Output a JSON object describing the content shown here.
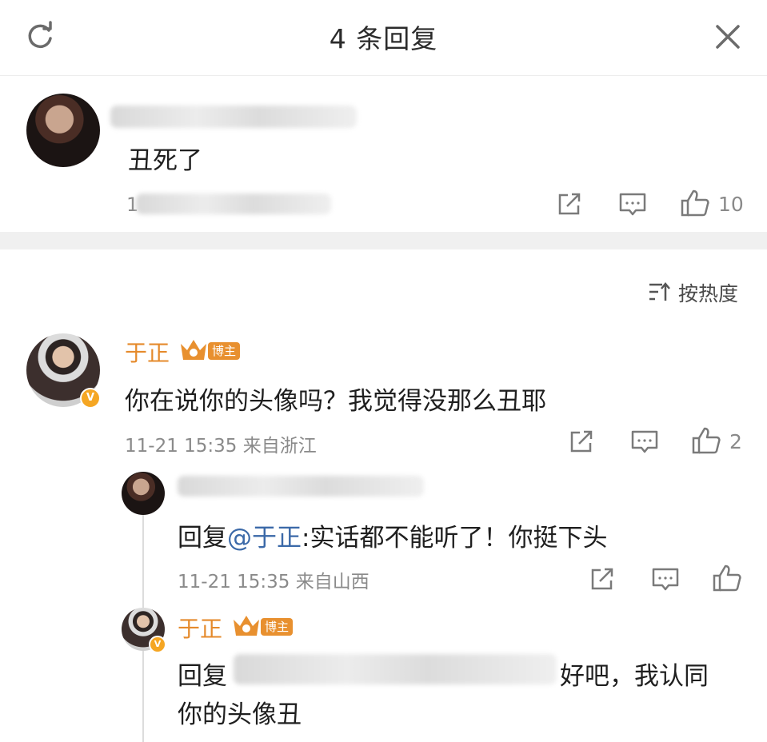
{
  "header": {
    "title": "4 条回复",
    "refresh_icon": "refresh-icon",
    "close_icon": "close-icon"
  },
  "main_comment": {
    "text": "丑死了",
    "date_prefix": "1",
    "likes": "10"
  },
  "sort": {
    "label": "按热度"
  },
  "replies": [
    {
      "author": "于正",
      "owner_tag": "博主",
      "text": "你在说你的头像吗？我觉得没那么丑耶",
      "meta": "11-21 15:35 来自浙江",
      "likes": "2"
    },
    {
      "reply_prefix": "回复",
      "mention": "@于正",
      "text": ":实话都不能听了！你挺下头",
      "meta": "11-21 15:35 来自山西"
    },
    {
      "author": "于正",
      "owner_tag": "博主",
      "reply_prefix": "回复",
      "text_1": "好吧，我认同",
      "text_2": "你的头像丑"
    }
  ],
  "colors": {
    "name": "#e58a2b",
    "owner_tag": "#e8902f",
    "mention": "#3b69a8",
    "verified": "#f5a623"
  }
}
